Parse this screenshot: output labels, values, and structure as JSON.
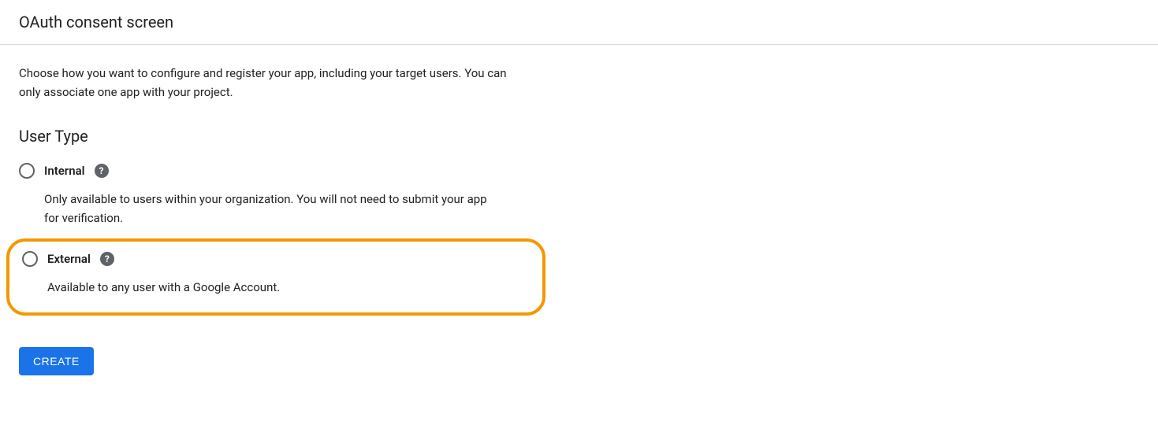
{
  "header": {
    "title": "OAuth consent screen"
  },
  "content": {
    "intro": "Choose how you want to configure and register your app, including your target users. You can only associate one app with your project.",
    "section_title": "User Type",
    "options": {
      "internal": {
        "label": "Internal",
        "description": "Only available to users within your organization. You will not need to submit your app for verification."
      },
      "external": {
        "label": "External",
        "description": "Available to any user with a Google Account."
      }
    },
    "create_button": "CREATE"
  }
}
